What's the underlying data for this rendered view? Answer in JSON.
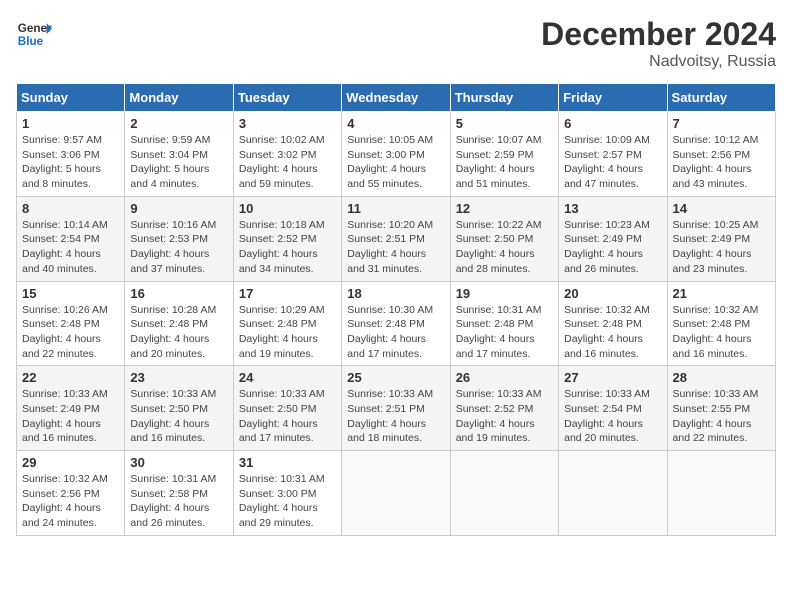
{
  "header": {
    "logo_line1": "General",
    "logo_line2": "Blue",
    "month": "December 2024",
    "location": "Nadvoitsy, Russia"
  },
  "days_of_week": [
    "Sunday",
    "Monday",
    "Tuesday",
    "Wednesday",
    "Thursday",
    "Friday",
    "Saturday"
  ],
  "weeks": [
    [
      {
        "day": "1",
        "info": "Sunrise: 9:57 AM\nSunset: 3:06 PM\nDaylight: 5 hours\nand 8 minutes."
      },
      {
        "day": "2",
        "info": "Sunrise: 9:59 AM\nSunset: 3:04 PM\nDaylight: 5 hours\nand 4 minutes."
      },
      {
        "day": "3",
        "info": "Sunrise: 10:02 AM\nSunset: 3:02 PM\nDaylight: 4 hours\nand 59 minutes."
      },
      {
        "day": "4",
        "info": "Sunrise: 10:05 AM\nSunset: 3:00 PM\nDaylight: 4 hours\nand 55 minutes."
      },
      {
        "day": "5",
        "info": "Sunrise: 10:07 AM\nSunset: 2:59 PM\nDaylight: 4 hours\nand 51 minutes."
      },
      {
        "day": "6",
        "info": "Sunrise: 10:09 AM\nSunset: 2:57 PM\nDaylight: 4 hours\nand 47 minutes."
      },
      {
        "day": "7",
        "info": "Sunrise: 10:12 AM\nSunset: 2:56 PM\nDaylight: 4 hours\nand 43 minutes."
      }
    ],
    [
      {
        "day": "8",
        "info": "Sunrise: 10:14 AM\nSunset: 2:54 PM\nDaylight: 4 hours\nand 40 minutes."
      },
      {
        "day": "9",
        "info": "Sunrise: 10:16 AM\nSunset: 2:53 PM\nDaylight: 4 hours\nand 37 minutes."
      },
      {
        "day": "10",
        "info": "Sunrise: 10:18 AM\nSunset: 2:52 PM\nDaylight: 4 hours\nand 34 minutes."
      },
      {
        "day": "11",
        "info": "Sunrise: 10:20 AM\nSunset: 2:51 PM\nDaylight: 4 hours\nand 31 minutes."
      },
      {
        "day": "12",
        "info": "Sunrise: 10:22 AM\nSunset: 2:50 PM\nDaylight: 4 hours\nand 28 minutes."
      },
      {
        "day": "13",
        "info": "Sunrise: 10:23 AM\nSunset: 2:49 PM\nDaylight: 4 hours\nand 26 minutes."
      },
      {
        "day": "14",
        "info": "Sunrise: 10:25 AM\nSunset: 2:49 PM\nDaylight: 4 hours\nand 23 minutes."
      }
    ],
    [
      {
        "day": "15",
        "info": "Sunrise: 10:26 AM\nSunset: 2:48 PM\nDaylight: 4 hours\nand 22 minutes."
      },
      {
        "day": "16",
        "info": "Sunrise: 10:28 AM\nSunset: 2:48 PM\nDaylight: 4 hours\nand 20 minutes."
      },
      {
        "day": "17",
        "info": "Sunrise: 10:29 AM\nSunset: 2:48 PM\nDaylight: 4 hours\nand 19 minutes."
      },
      {
        "day": "18",
        "info": "Sunrise: 10:30 AM\nSunset: 2:48 PM\nDaylight: 4 hours\nand 17 minutes."
      },
      {
        "day": "19",
        "info": "Sunrise: 10:31 AM\nSunset: 2:48 PM\nDaylight: 4 hours\nand 17 minutes."
      },
      {
        "day": "20",
        "info": "Sunrise: 10:32 AM\nSunset: 2:48 PM\nDaylight: 4 hours\nand 16 minutes."
      },
      {
        "day": "21",
        "info": "Sunrise: 10:32 AM\nSunset: 2:48 PM\nDaylight: 4 hours\nand 16 minutes."
      }
    ],
    [
      {
        "day": "22",
        "info": "Sunrise: 10:33 AM\nSunset: 2:49 PM\nDaylight: 4 hours\nand 16 minutes."
      },
      {
        "day": "23",
        "info": "Sunrise: 10:33 AM\nSunset: 2:50 PM\nDaylight: 4 hours\nand 16 minutes."
      },
      {
        "day": "24",
        "info": "Sunrise: 10:33 AM\nSunset: 2:50 PM\nDaylight: 4 hours\nand 17 minutes."
      },
      {
        "day": "25",
        "info": "Sunrise: 10:33 AM\nSunset: 2:51 PM\nDaylight: 4 hours\nand 18 minutes."
      },
      {
        "day": "26",
        "info": "Sunrise: 10:33 AM\nSunset: 2:52 PM\nDaylight: 4 hours\nand 19 minutes."
      },
      {
        "day": "27",
        "info": "Sunrise: 10:33 AM\nSunset: 2:54 PM\nDaylight: 4 hours\nand 20 minutes."
      },
      {
        "day": "28",
        "info": "Sunrise: 10:33 AM\nSunset: 2:55 PM\nDaylight: 4 hours\nand 22 minutes."
      }
    ],
    [
      {
        "day": "29",
        "info": "Sunrise: 10:32 AM\nSunset: 2:56 PM\nDaylight: 4 hours\nand 24 minutes."
      },
      {
        "day": "30",
        "info": "Sunrise: 10:31 AM\nSunset: 2:58 PM\nDaylight: 4 hours\nand 26 minutes."
      },
      {
        "day": "31",
        "info": "Sunrise: 10:31 AM\nSunset: 3:00 PM\nDaylight: 4 hours\nand 29 minutes."
      },
      null,
      null,
      null,
      null
    ]
  ]
}
